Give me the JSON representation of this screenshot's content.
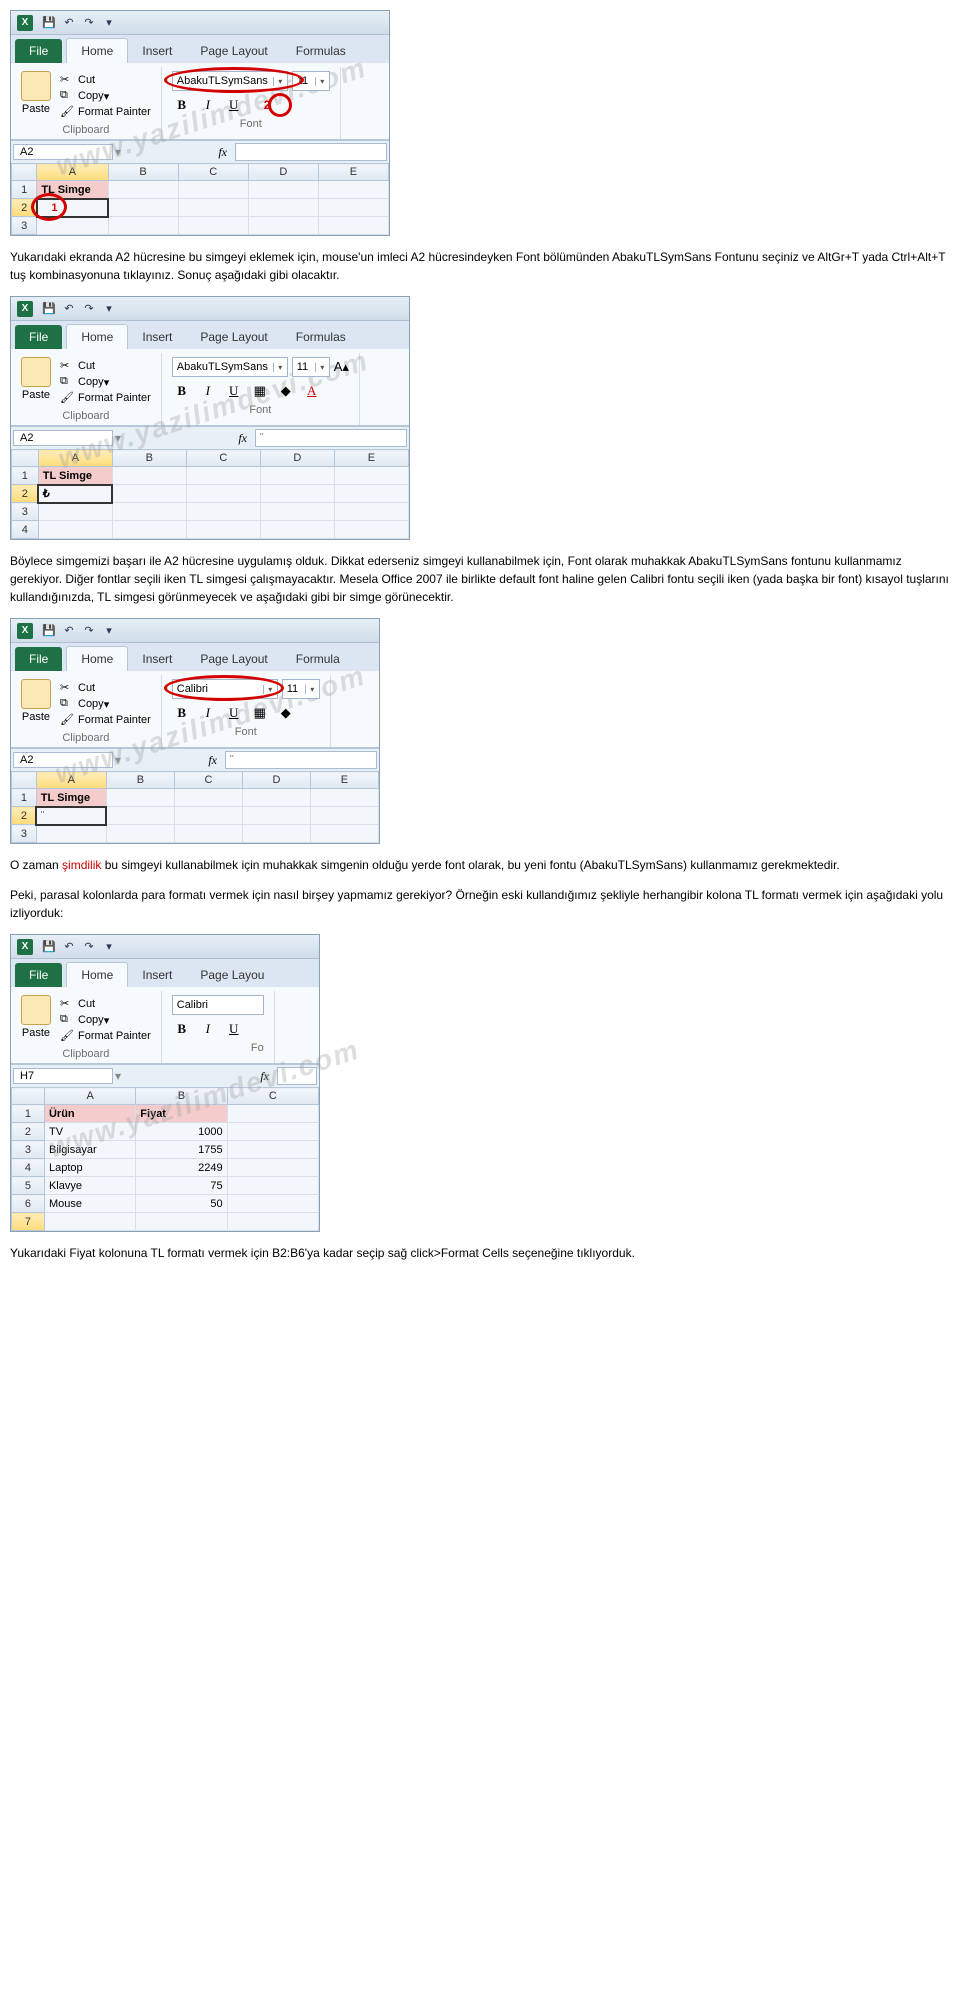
{
  "watermark": "www.yazilimdevi.com",
  "excel_common": {
    "tabs": {
      "file": "File",
      "home": "Home",
      "insert": "Insert",
      "pagelayout": "Page Layout",
      "formulas": "Formulas"
    },
    "paste": "Paste",
    "cut": "Cut",
    "copy": "Copy",
    "format_painter": "Format Painter",
    "clipboard": "Clipboard",
    "font_group": "Font",
    "bold": "B",
    "italic": "I",
    "underline": "U",
    "fx": "fx"
  },
  "shot1": {
    "font_name": "AbakuTLSymSans",
    "font_size": "11",
    "cellref": "A2",
    "fx_value": "",
    "cols": [
      "A",
      "B",
      "C",
      "D",
      "E"
    ],
    "rows": [
      "1",
      "2",
      "3"
    ],
    "a1": "TL Simge",
    "a2": "1",
    "circle_label": "2"
  },
  "para1": "Yukarıdaki ekranda A2 hücresine bu simgeyi eklemek için, mouse'un imleci A2 hücresindeyken Font bölümünden AbakuTLSymSans Fontunu seçiniz ve AltGr+T yada Ctrl+Alt+T tuş kombinasyonuna tıklayınız. Sonuç aşağıdaki gibi olacaktır.",
  "shot2": {
    "font_name": "AbakuTLSymSans",
    "font_size": "11",
    "cellref": "A2",
    "fx_value": "¨",
    "cols": [
      "A",
      "B",
      "C",
      "D",
      "E"
    ],
    "rows": [
      "1",
      "2",
      "3",
      "4"
    ],
    "a1": "TL Simge",
    "a2": "₺"
  },
  "para2": "Böylece simgemizi başarı ile A2 hücresine uygulamış olduk. Dikkat ederseniz simgeyi kullanabilmek için, Font olarak muhakkak AbakuTLSymSans fontunu kullanmamız gerekiyor. Diğer fontlar seçili iken TL simgesi çalışmayacaktır. Mesela Office 2007 ile birlikte default font haline gelen Calibri fontu seçili iken (yada başka bir font) kısayol tuşlarını kullandığınızda, TL simgesi görünmeyecek ve aşağıdaki gibi bir simge görünecektir.",
  "shot3": {
    "font_name": "Calibri",
    "font_size": "11",
    "cellref": "A2",
    "fx_value": "¨",
    "cols": [
      "A",
      "B",
      "C",
      "D",
      "E"
    ],
    "rows": [
      "1",
      "2",
      "3"
    ],
    "a1": "TL Simge",
    "a2": "¨"
  },
  "para3a": "O zaman ",
  "para3b": "şimdilik",
  "para3c": " bu simgeyi kullanabilmek için muhakkak simgenin olduğu yerde font olarak, bu yeni fontu (AbakuTLSymSans) kullanmamız gerekmektedir.",
  "para4": "Peki, parasal kolonlarda para formatı vermek için nasıl birşey yapmamız gerekiyor? Örneğin eski kullandığımız şekliyle herhangibir kolona TL formatı vermek için aşağıdaki yolu izliyorduk:",
  "shot4": {
    "font_name": "Calibri",
    "cellref": "H7",
    "fx_value": "",
    "cols": [
      "A",
      "B",
      "C"
    ],
    "headers": {
      "a1": "Ürün",
      "b1": "Fiyat"
    },
    "data": [
      {
        "row": "2",
        "a": "TV",
        "b": "1000"
      },
      {
        "row": "3",
        "a": "Bilgisayar",
        "b": "1755"
      },
      {
        "row": "4",
        "a": "Laptop",
        "b": "2249"
      },
      {
        "row": "5",
        "a": "Klavye",
        "b": "75"
      },
      {
        "row": "6",
        "a": "Mouse",
        "b": "50"
      }
    ],
    "row7": "7"
  },
  "para5": "Yukarıdaki Fiyat kolonuna TL formatı vermek için B2:B6'ya kadar seçip sağ click>Format Cells seçeneğine tıklıyorduk."
}
